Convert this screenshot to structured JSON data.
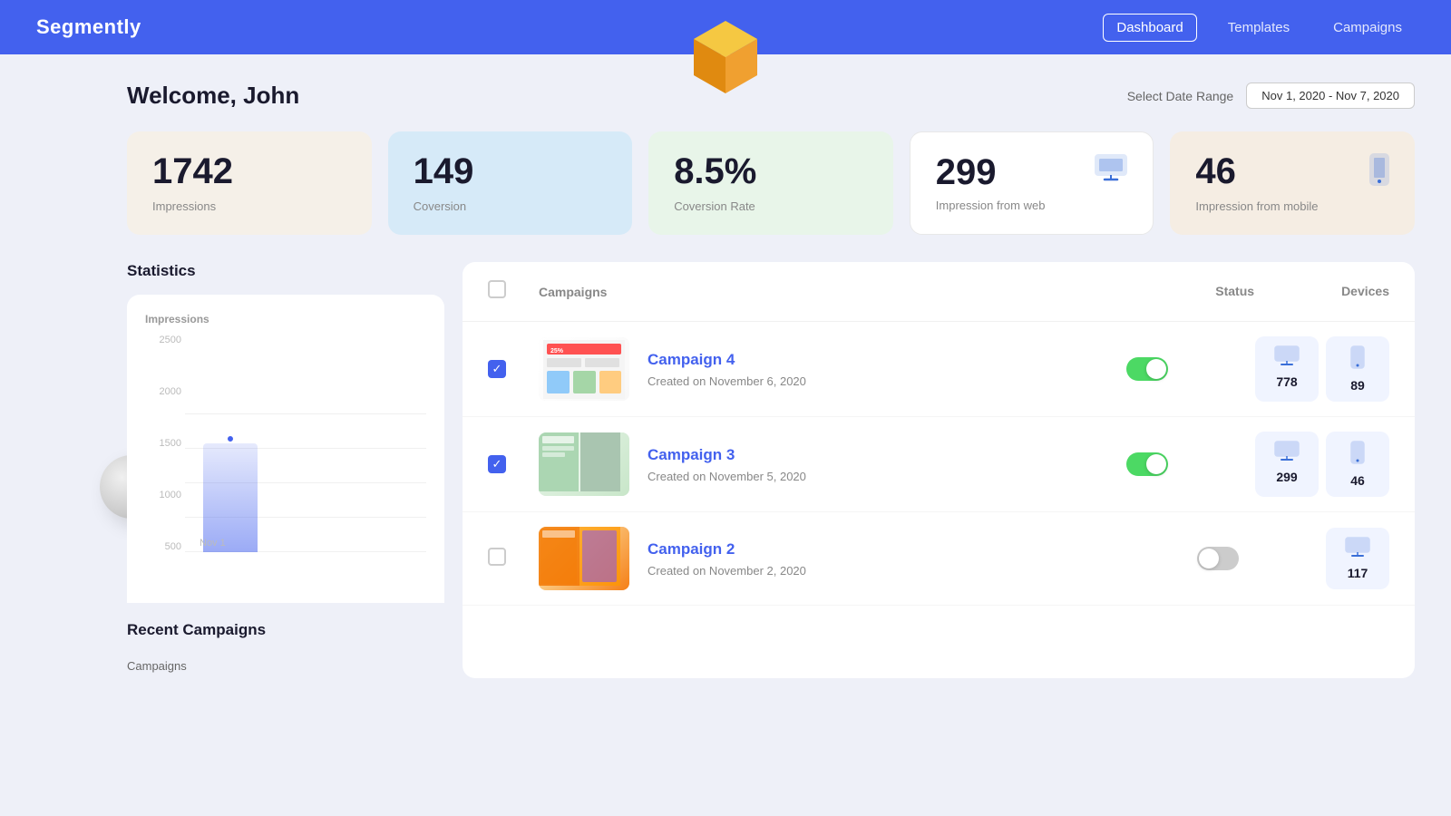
{
  "navbar": {
    "brand": "Segmently",
    "links": [
      {
        "label": "Dashboard",
        "active": true
      },
      {
        "label": "Templates",
        "active": false
      },
      {
        "label": "Campaigns",
        "active": false
      }
    ]
  },
  "header": {
    "welcome": "Welcome, John",
    "date_range_label": "Select Date Range",
    "date_range_value": "Nov 1, 2020 - Nov 7, 2020"
  },
  "stat_cards": [
    {
      "number": "1742",
      "label": "Impressions",
      "style": "beige"
    },
    {
      "number": "149",
      "label": "Coversion",
      "style": "blue-light"
    },
    {
      "number": "8.5%",
      "label": "Coversion Rate",
      "style": "green-light"
    },
    {
      "number": "299",
      "label": "Impression from web",
      "style": "white-bordered",
      "icon": "monitor"
    },
    {
      "number": "46",
      "label": "Impression from mobile",
      "style": "peach",
      "icon": "mobile"
    }
  ],
  "statistics": {
    "title": "Statistics",
    "chart_label": "Impressions",
    "y_ticks": [
      "2500",
      "2000",
      "1500",
      "1000",
      "500"
    ],
    "x_label": "Nov 1"
  },
  "recent_campaigns": {
    "title": "Recent Campaigns",
    "label": "Campaigns"
  },
  "campaigns_table": {
    "headers": {
      "campaigns": "Campaigns",
      "status": "Status",
      "devices": "Devices"
    },
    "rows": [
      {
        "id": 4,
        "name": "Campaign 4",
        "date": "Created on November 6, 2020",
        "checked": true,
        "active": true,
        "web_count": "778",
        "mobile_count": "89",
        "thumb_style": "campaign4"
      },
      {
        "id": 3,
        "name": "Campaign 3",
        "date": "Created on November 5, 2020",
        "checked": true,
        "active": true,
        "web_count": "299",
        "mobile_count": "46",
        "thumb_style": "campaign3"
      },
      {
        "id": 2,
        "name": "Campaign 2",
        "date": "Created on November 2, 2020",
        "checked": false,
        "active": false,
        "web_count": "117",
        "mobile_count": null,
        "thumb_style": "campaign2"
      }
    ]
  }
}
